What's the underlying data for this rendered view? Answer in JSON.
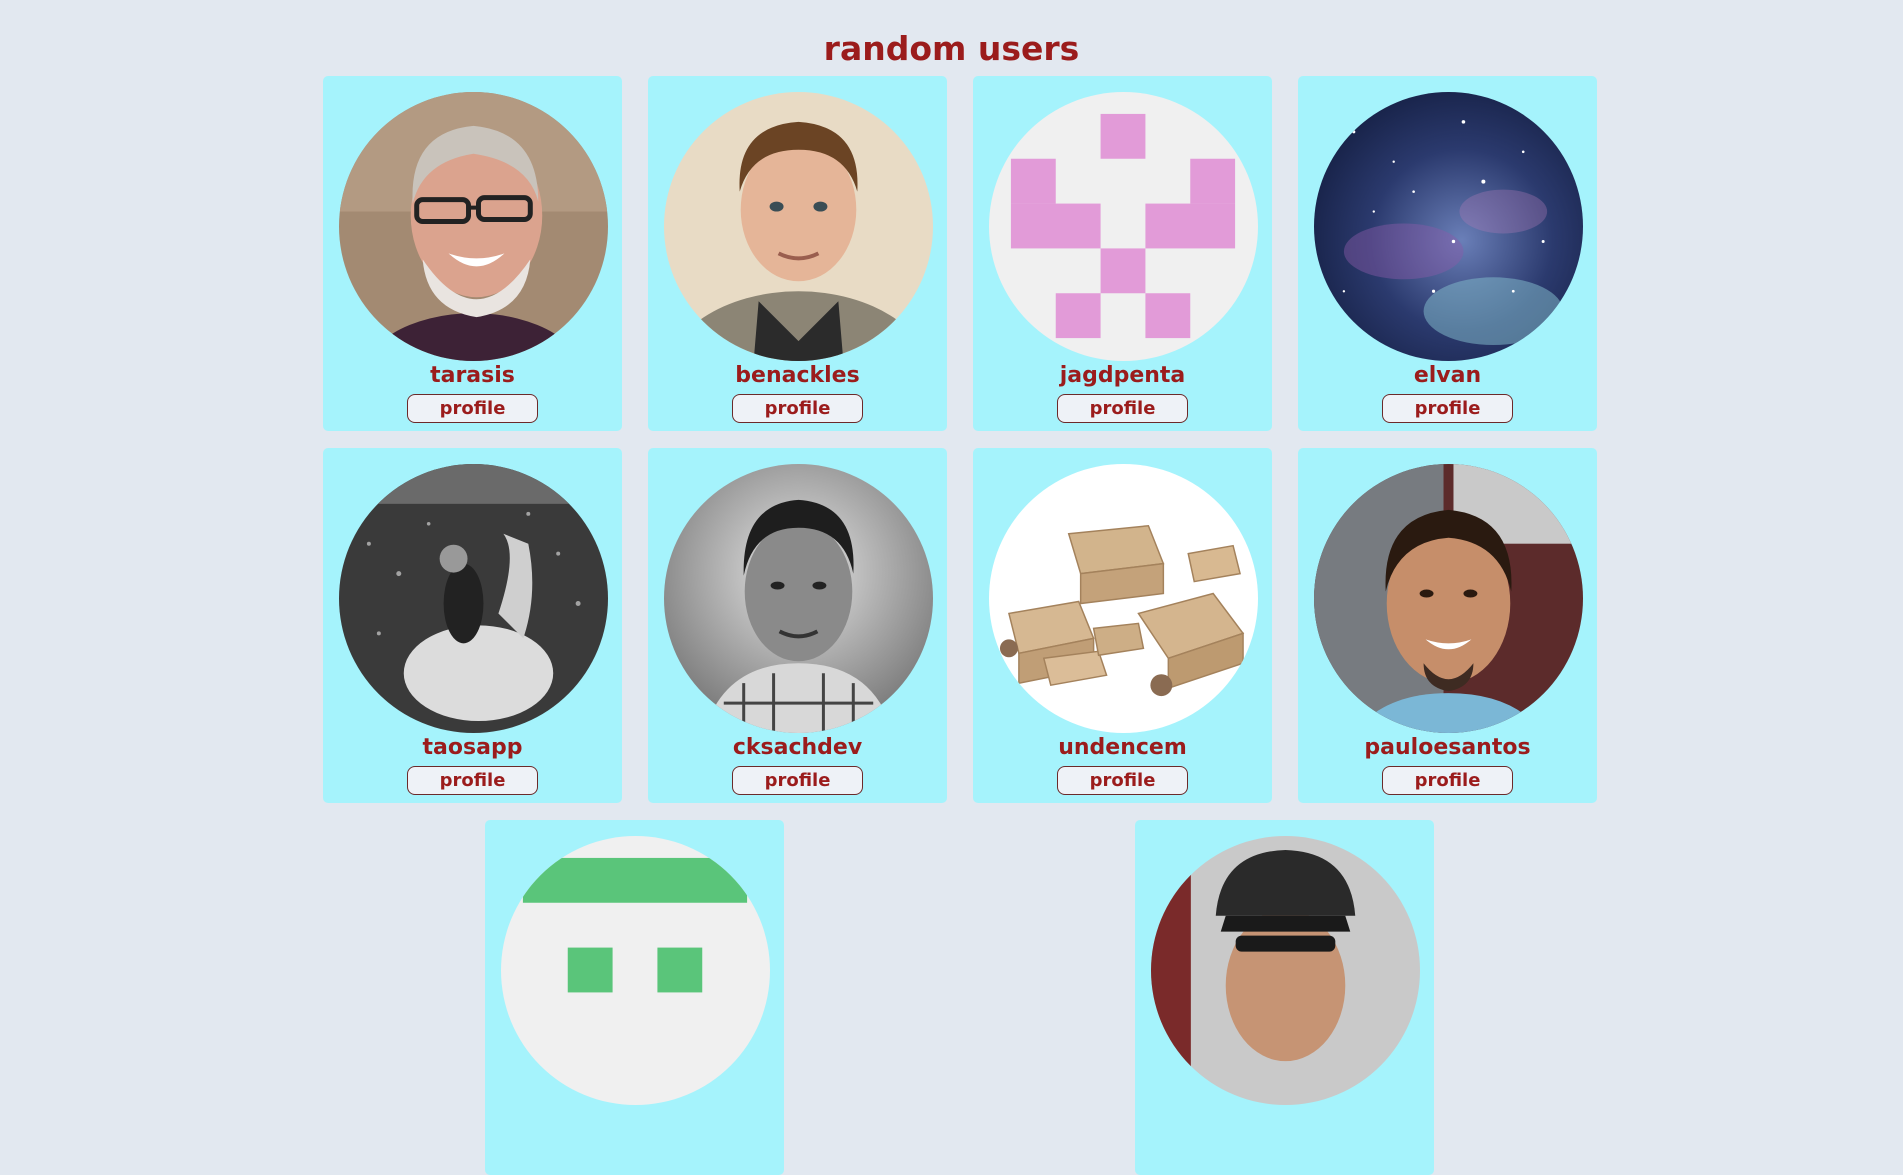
{
  "page": {
    "title": "random users",
    "background_color": "#e2e8f0",
    "card_color": "#a5f3fc",
    "accent_color": "#9b1c1c"
  },
  "users": [
    {
      "username": "tarasis",
      "button_label": "profile",
      "avatar": "photo-laughing-man-glasses"
    },
    {
      "username": "benackles",
      "button_label": "profile",
      "avatar": "photo-young-man-smiling"
    },
    {
      "username": "jagdpenta",
      "button_label": "profile",
      "avatar": "pink-identicon"
    },
    {
      "username": "elvan",
      "button_label": "profile",
      "avatar": "galaxy-nebula-image"
    },
    {
      "username": "taosapp",
      "button_label": "profile",
      "avatar": "bw-photo-rider-on-horse-in-water"
    },
    {
      "username": "cksachdev",
      "button_label": "profile",
      "avatar": "bw-portrait-man"
    },
    {
      "username": "undencem",
      "button_label": "profile",
      "avatar": "cardboard-boxes-image"
    },
    {
      "username": "pauloesantos",
      "button_label": "profile",
      "avatar": "photo-smiling-man-goatee"
    },
    {
      "username": "",
      "button_label": "",
      "avatar": "green-identicon"
    },
    {
      "username": "",
      "button_label": "",
      "avatar": "photo-man-cap-sunglasses"
    }
  ]
}
